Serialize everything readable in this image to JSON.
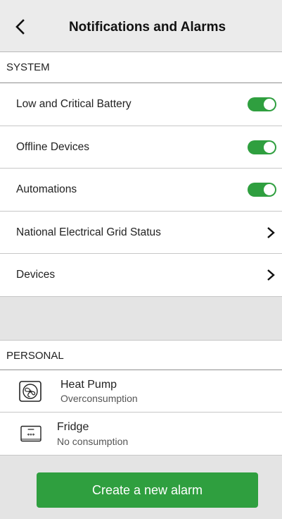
{
  "header": {
    "back_icon": "chevron-left-icon",
    "title": "Notifications and Alarms"
  },
  "system": {
    "heading": "SYSTEM",
    "items": [
      {
        "label": "Low and Critical Battery",
        "control": "toggle",
        "on": true
      },
      {
        "label": "Offline Devices",
        "control": "toggle",
        "on": true
      },
      {
        "label": "Automations",
        "control": "toggle",
        "on": true
      },
      {
        "label": "National Electrical Grid Status",
        "control": "chevron"
      },
      {
        "label": "Devices",
        "control": "chevron"
      }
    ]
  },
  "personal": {
    "heading": "PERSONAL",
    "items": [
      {
        "icon": "heat-pump-icon",
        "title": "Heat Pump",
        "subtitle": "Overconsumption"
      },
      {
        "icon": "fridge-icon",
        "title": "Fridge",
        "subtitle": "No consumption"
      }
    ]
  },
  "cta": {
    "label": "Create a new alarm"
  },
  "colors": {
    "accent": "#2f9f3f",
    "background": "#e4e4e4",
    "surface": "#ffffff"
  }
}
